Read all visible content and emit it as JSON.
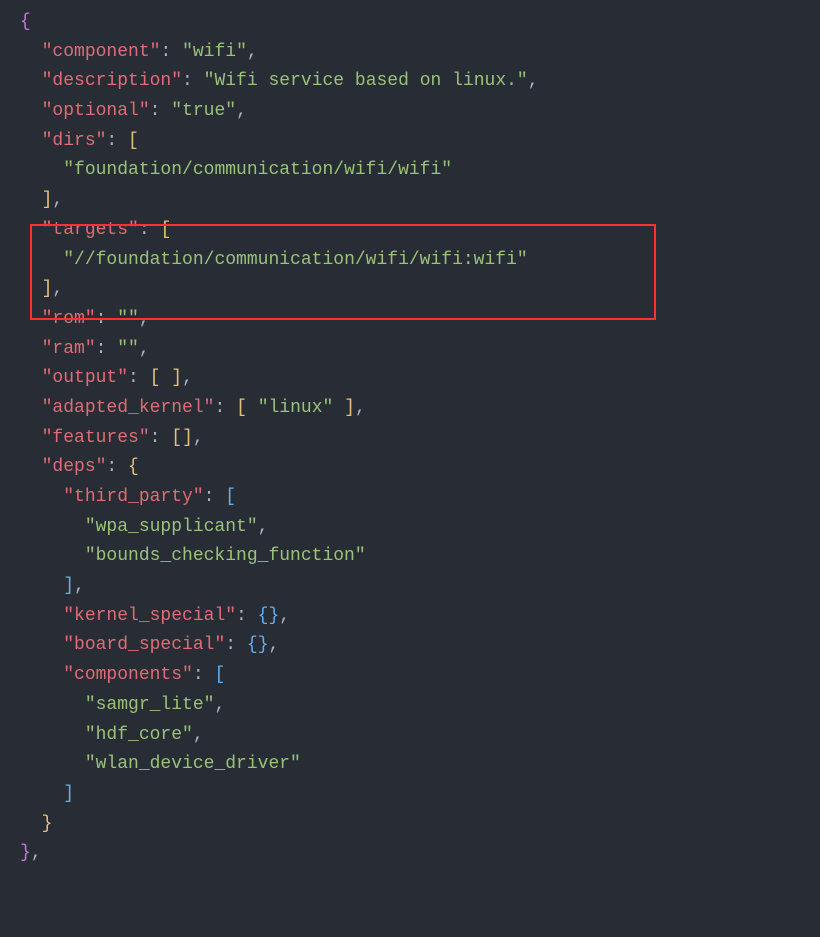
{
  "code": {
    "keys": {
      "component": "\"component\"",
      "description": "\"description\"",
      "optional": "\"optional\"",
      "dirs": "\"dirs\"",
      "targets": "\"targets\"",
      "rom": "\"rom\"",
      "ram": "\"ram\"",
      "output": "\"output\"",
      "adapted_kernel": "\"adapted_kernel\"",
      "features": "\"features\"",
      "deps": "\"deps\"",
      "third_party": "\"third_party\"",
      "kernel_special": "\"kernel_special\"",
      "board_special": "\"board_special\"",
      "components": "\"components\""
    },
    "values": {
      "component": "\"wifi\"",
      "description": "\"Wifi service based on linux.\"",
      "optional": "\"true\"",
      "dirs0": "\"foundation/communication/wifi/wifi\"",
      "targets0": "\"//foundation/communication/wifi/wifi:wifi\"",
      "rom": "\"\"",
      "ram": "\"\"",
      "adapted_kernel0": "\"linux\"",
      "third_party0": "\"wpa_supplicant\"",
      "third_party1": "\"bounds_checking_function\"",
      "components0": "\"samgr_lite\"",
      "components1": "\"hdf_core\"",
      "components2": "\"wlan_device_driver\""
    },
    "punct": {
      "open_brace": "{",
      "close_brace": "}",
      "open_bracket": "[",
      "close_bracket": "]",
      "colon": ":",
      "comma": ",",
      "space": " ",
      "empty_arr": "[ ]",
      "empty_obj": "{}",
      "empty_arr2": "[]"
    }
  }
}
